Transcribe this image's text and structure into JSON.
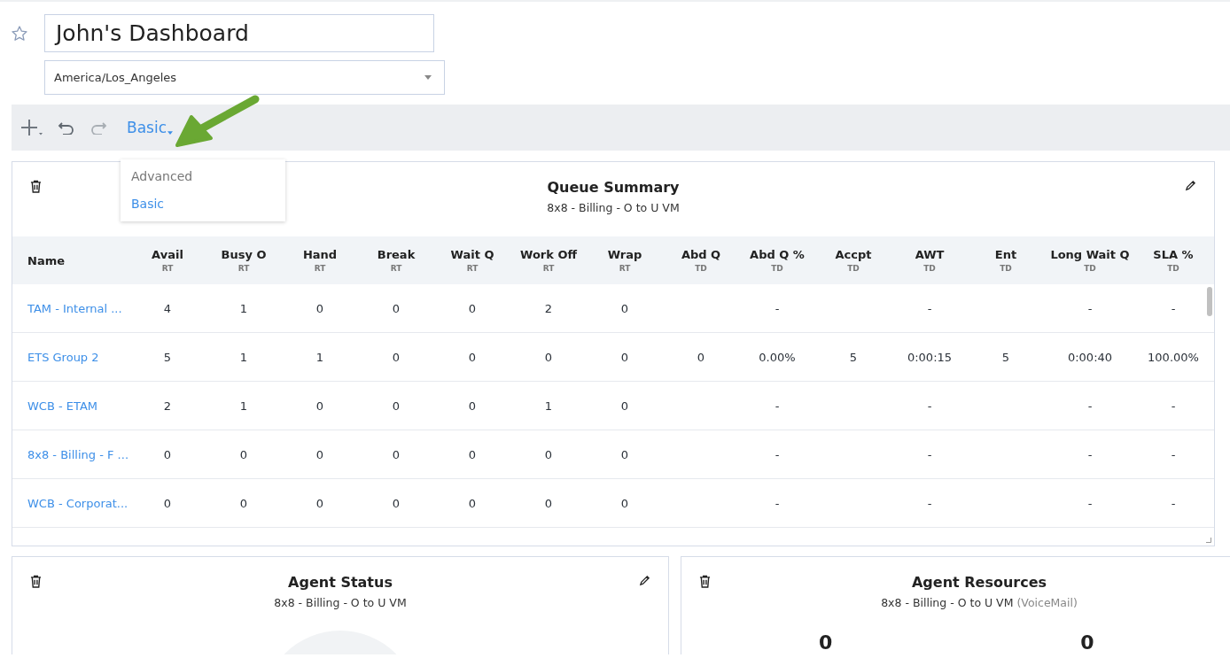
{
  "dashboard": {
    "title": "John's Dashboard",
    "starred": false,
    "timezone": "America/Los_Angeles"
  },
  "toolbar": {
    "view": "Basic",
    "menu": [
      {
        "label": "Advanced",
        "selected": false
      },
      {
        "label": "Basic",
        "selected": true
      }
    ]
  },
  "queue_summary": {
    "title": "Queue Summary",
    "subtitle": "8x8 - Billing - O to U VM",
    "columns": [
      {
        "label": "Name"
      },
      {
        "label": "Avail",
        "sub": "RT"
      },
      {
        "label": "Busy O",
        "sub": "RT"
      },
      {
        "label": "Hand",
        "sub": "RT"
      },
      {
        "label": "Break",
        "sub": "RT"
      },
      {
        "label": "Wait Q",
        "sub": "RT"
      },
      {
        "label": "Work Off",
        "sub": "RT"
      },
      {
        "label": "Wrap",
        "sub": "RT"
      },
      {
        "label": "Abd Q",
        "sub": "TD"
      },
      {
        "label": "Abd Q %",
        "sub": "TD"
      },
      {
        "label": "Accpt",
        "sub": "TD"
      },
      {
        "label": "AWT",
        "sub": "TD"
      },
      {
        "label": "Ent",
        "sub": "TD"
      },
      {
        "label": "Long Wait Q",
        "sub": "TD"
      },
      {
        "label": "SLA %",
        "sub": "TD"
      }
    ],
    "rows": [
      {
        "cells": [
          "TAM - Internal ...",
          "4",
          "1",
          "0",
          "0",
          "0",
          "2",
          "0",
          null,
          "-",
          null,
          "-",
          null,
          "-",
          "-"
        ]
      },
      {
        "cells": [
          "ETS Group 2",
          "5",
          "1",
          "1",
          "0",
          "0",
          "0",
          "0",
          "0",
          "0.00%",
          "5",
          "0:00:15",
          "5",
          "0:00:40",
          "100.00%"
        ]
      },
      {
        "cells": [
          "WCB - ETAM",
          "2",
          "1",
          "0",
          "0",
          "0",
          "1",
          "0",
          null,
          "-",
          null,
          "-",
          null,
          "-",
          "-"
        ]
      },
      {
        "cells": [
          "8x8 - Billing - F ...",
          "0",
          "0",
          "0",
          "0",
          "0",
          "0",
          "0",
          null,
          "-",
          null,
          "-",
          null,
          "-",
          "-"
        ]
      },
      {
        "cells": [
          "WCB - Corporat...",
          "0",
          "0",
          "0",
          "0",
          "0",
          "0",
          "0",
          null,
          "-",
          null,
          "-",
          null,
          "-",
          "-"
        ]
      }
    ]
  },
  "agent_status": {
    "title": "Agent Status",
    "subtitle": "8x8 - Billing - O to U VM"
  },
  "agent_resources": {
    "title": "Agent Resources",
    "subtitle": "8x8 - Billing - O to U VM",
    "note": "(VoiceMail)",
    "values": [
      "0",
      "0"
    ]
  }
}
